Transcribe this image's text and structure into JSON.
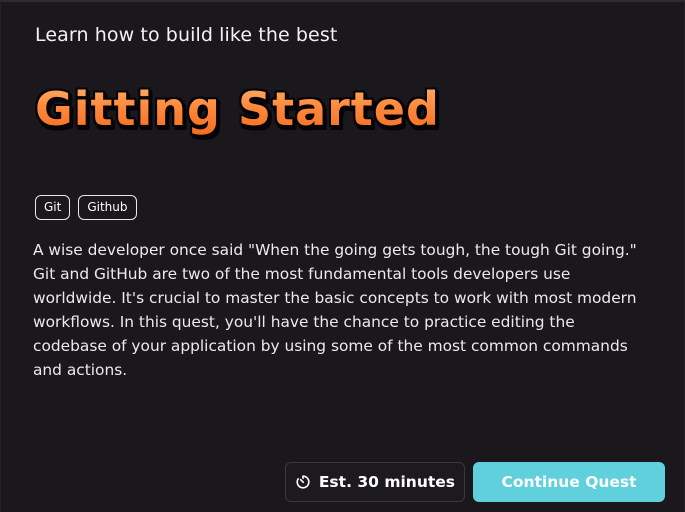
{
  "header": {
    "subtitle": "Learn how to build like the best",
    "title": "Gitting Started"
  },
  "tags": [
    "Git",
    "Github"
  ],
  "description": "A wise developer once said \"When the going gets tough, the tough Git going.\" Git and GitHub are two of the most fundamental tools developers use worldwide. It's crucial to master the basic concepts to work with most modern workflows. In this quest, you'll have the chance to practice editing the codebase of your application by using some of the most common commands and actions.",
  "footer": {
    "estimate_icon": "timer-icon",
    "estimate_label": "Est. 30 minutes",
    "continue_label": "Continue Quest"
  },
  "colors": {
    "background": "#1a181d",
    "title_orange": "#ff8a3d",
    "accent_cyan": "#5fd0dc"
  }
}
